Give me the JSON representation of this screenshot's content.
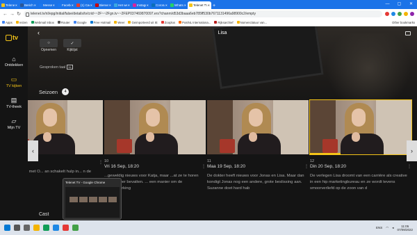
{
  "browser": {
    "tabs": [
      {
        "label": "Telenet |",
        "color": "#f5c518"
      },
      {
        "label": "Bericht |",
        "color": "#2b5797"
      },
      {
        "label": "Messeng",
        "color": "#1877f2"
      },
      {
        "label": "Facebook",
        "color": "#1877f2"
      },
      {
        "label": "(1) Cancl",
        "color": "#e03c31"
      },
      {
        "label": "Bienvenu",
        "color": "#cc0000"
      },
      {
        "label": "Het weer",
        "color": "#3aa8e0"
      },
      {
        "label": "Instagram",
        "color": "#d6249f"
      },
      {
        "label": "Coronavi",
        "color": "#0b6fb8"
      },
      {
        "label": "WhatsAp",
        "color": "#25d366"
      },
      {
        "label": "Telenet TV",
        "color": "#f5c518",
        "active": true
      }
    ],
    "new_tab": "+",
    "url": "telenet.tv/nl/epg/initial/false/details/tv/crid~~2F~~2Fgn.tv~~2FEP037469870097.ers?chanm/d53d3baaa6eb785ff530b7671131496a98900c2/empty",
    "bookmarks": [
      {
        "label": "Apps",
        "color": "#4285f4"
      },
      {
        "label": "reizen",
        "color": "#f4b400"
      },
      {
        "label": "Webmail Inbox",
        "color": "#0f9d58"
      },
      {
        "label": "Router",
        "color": "#555555"
      },
      {
        "label": "Google",
        "color": "#4285f4"
      },
      {
        "label": "Free Hotmail",
        "color": "#0078d4"
      },
      {
        "label": "Weer",
        "color": "#f4b400"
      },
      {
        "label": "Geimporteerd uit IE",
        "color": "#f4b400"
      },
      {
        "label": "Zooplus",
        "color": "#e53935"
      },
      {
        "label": "PostNL Internationa...",
        "color": "#ff6f00"
      },
      {
        "label": "Rijksarchief",
        "color": "#b71c1c"
      },
      {
        "label": "Nomenclatuur van...",
        "color": "#f4b400"
      }
    ],
    "other_bookmarks": "Other bookmarks"
  },
  "app": {
    "logo_text": "tv",
    "nav": [
      {
        "label": "Ontdekken",
        "icon": "home-icon"
      },
      {
        "label": "TV kijken",
        "icon": "tv-icon",
        "active": true
      },
      {
        "label": "TV-theek",
        "icon": "film-icon"
      },
      {
        "label": "Mijn TV",
        "icon": "folder-icon"
      }
    ],
    "page_title": "Lisa",
    "actions": [
      {
        "label": "Opnemen",
        "glyph": "○"
      },
      {
        "label": "Kijklijst",
        "glyph": "✓"
      }
    ],
    "language": "Gesproken taal",
    "language_badge": "NL",
    "season_label": "Seizoen",
    "season_number": "4",
    "episodes": [
      {
        "ep": "",
        "date": "Sep, 18:20",
        "desc": "samenwerking met O... an schakelt hulp in... n de Keetal. Katj...",
        "progress": 0
      },
      {
        "ep": "10",
        "date": "Vri 16 Sep, 18:20",
        "desc": "...geweldig nieuws voor Katja, maar ...at ze te horen krijgt amper bevatten. ... een manier om de samenwerking",
        "progress": 0
      },
      {
        "ep": "11",
        "date": "Maa 19 Sep, 18:20",
        "desc": "De dokter heeft nieuws voor Jonas en Lisa. Maar dan kondigt Jonas nog een andere, grote beslissing aan. Suzanne doet hard hab",
        "progress": 0
      },
      {
        "ep": "12",
        "date": "Din 20 Sep, 18:20",
        "desc": "De verlegen Lisa droomt van een carrière als creative in een hip marketingbureau en ze wordt tevens smoorverliefd op de zoon van d",
        "progress": 0.3,
        "selected": true
      }
    ],
    "cast_label": "Cast"
  },
  "taskbar_preview": "Telenet TV - Google Chrome",
  "tray": {
    "lang": "ENS",
    "time": "11:05",
    "date": "07/09/2022"
  },
  "colors": {
    "accent": "#f5c518",
    "chrome_blue": "#1b73e8"
  }
}
